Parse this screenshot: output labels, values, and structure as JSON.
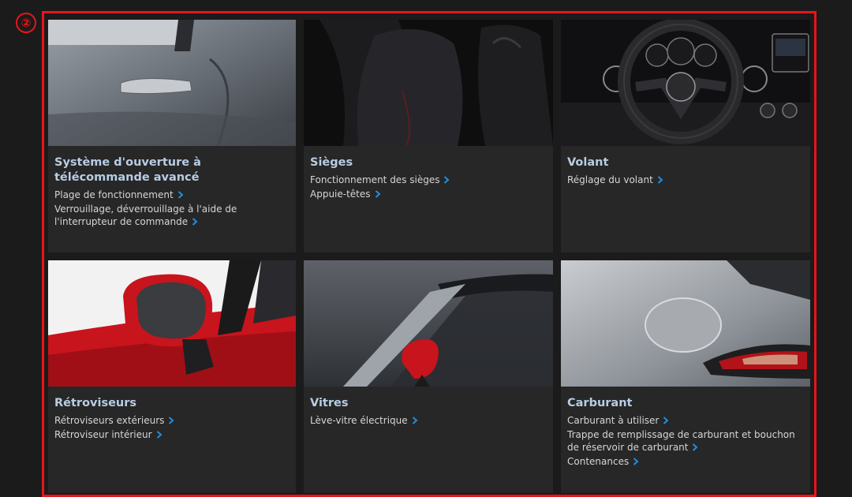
{
  "marker": "②",
  "cards": [
    {
      "title": "Système d'ouverture à télécommande avancé",
      "links": [
        {
          "label": "Plage de fonctionnement"
        },
        {
          "label": "Verrouillage, déverrouillage à l'aide de l'interrupteur de commande"
        }
      ]
    },
    {
      "title": "Sièges",
      "links": [
        {
          "label": "Fonctionnement des sièges"
        },
        {
          "label": "Appuie-têtes"
        }
      ]
    },
    {
      "title": "Volant",
      "links": [
        {
          "label": "Réglage du volant"
        }
      ]
    },
    {
      "title": "Rétroviseurs",
      "links": [
        {
          "label": "Rétroviseurs extérieurs"
        },
        {
          "label": "Rétroviseur intérieur"
        }
      ]
    },
    {
      "title": "Vitres",
      "links": [
        {
          "label": "Lève-vitre électrique"
        }
      ]
    },
    {
      "title": "Carburant",
      "links": [
        {
          "label": "Carburant à utiliser"
        },
        {
          "label": "Trappe de remplissage de carburant et bouchon de réservoir de carburant"
        },
        {
          "label": "Contenances"
        }
      ]
    }
  ],
  "colors": {
    "highlight": "#e8141b",
    "title": "#b7cde4",
    "chevron": "#1e8fe0",
    "card_bg": "#272727",
    "page_bg": "#1b1b1b"
  }
}
